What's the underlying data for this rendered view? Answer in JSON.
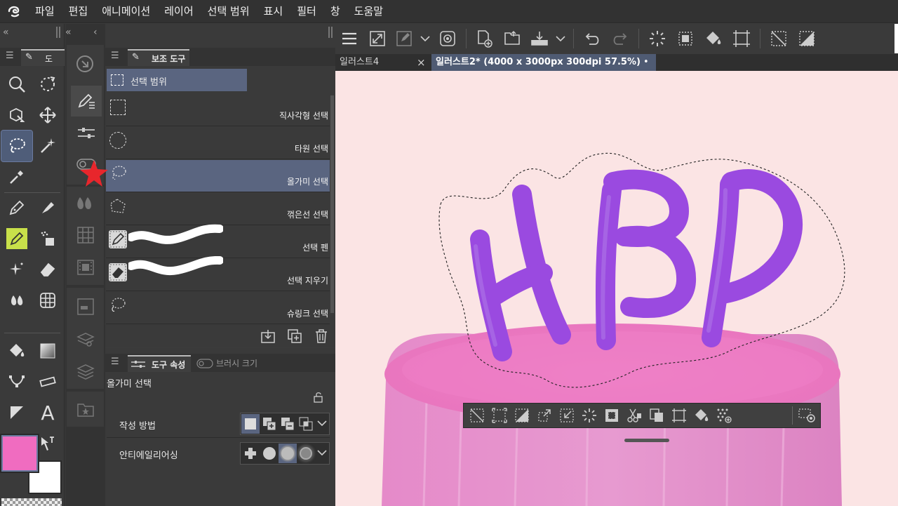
{
  "menubar": {
    "items": [
      "파일",
      "편집",
      "애니메이션",
      "레이어",
      "선택 범위",
      "표시",
      "필터",
      "창",
      "도움말"
    ]
  },
  "left_toolbox": {
    "tab_label": "도",
    "tools": [
      "zoom",
      "rotate",
      "object",
      "move",
      "lasso",
      "auto-select",
      "eyedropper",
      "pen",
      "ink-bottle",
      "marker",
      "spray",
      "sparkle",
      "eraser",
      "blend",
      "frame",
      "fill",
      "gradient",
      "figure",
      "ruler",
      "text-shape",
      "text",
      "balloon",
      "correction"
    ]
  },
  "colors": {
    "main_color": "#f06cc0",
    "sub_color": "#ffffff",
    "accent": "#5a6580",
    "canvas_bg": "#fbe4e4",
    "stroke_purple": "#9a4ae0"
  },
  "subtool_panel": {
    "tab_label": "보조 도구",
    "group_label": "선택 범위",
    "items": [
      {
        "label": "직사각형 선택",
        "icon": "rect-select-icon"
      },
      {
        "label": "타원 선택",
        "icon": "ellipse-select-icon"
      },
      {
        "label": "올가미 선택",
        "icon": "lasso-select-icon"
      },
      {
        "label": "꺾은선 선택",
        "icon": "polyline-select-icon"
      },
      {
        "label": "선택 펜",
        "icon": "select-pen-icon"
      },
      {
        "label": "선택 지우기",
        "icon": "select-eraser-icon"
      },
      {
        "label": "슈링크 선택",
        "icon": "shrink-select-icon"
      }
    ]
  },
  "tool_property": {
    "tab_label": "도구 속성",
    "tab2_label": "브러시 크기",
    "title": "올가미 선택",
    "rows": [
      {
        "label": "작성 방법"
      },
      {
        "label": "안티에일리어싱"
      }
    ]
  },
  "tabs": [
    {
      "label": "일러스트4",
      "close": "×"
    },
    {
      "label": "일러스트2* (4000 x 3000px 300dpi 57.5%)",
      "dot": "•"
    }
  ],
  "canvas": {
    "text": "HBP"
  }
}
